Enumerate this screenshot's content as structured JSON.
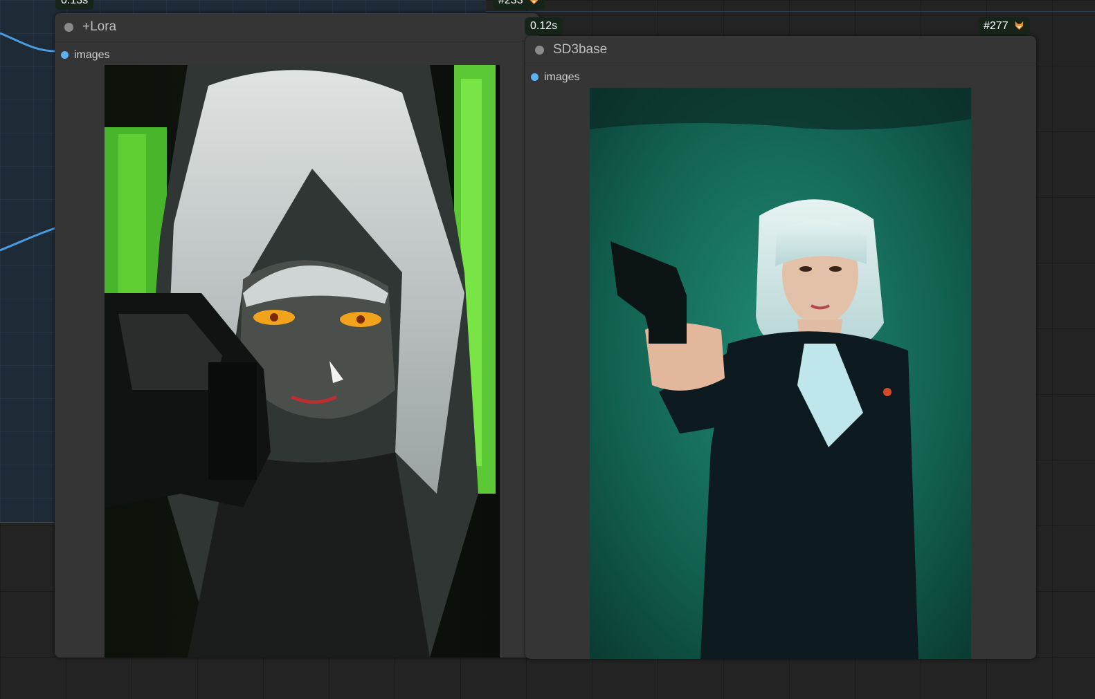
{
  "badges": {
    "time_top_left": "0.13s",
    "id_top": "#233",
    "time_right": "0.12s",
    "id_right": "#277"
  },
  "nodes": [
    {
      "title": "+Lora",
      "output_label": "images",
      "image_description": "anime-style girl with silver hair and glowing orange eyes aiming a pistol, green neon background"
    },
    {
      "title": "SD3base",
      "output_label": "images",
      "image_description": "photo of woman with white bob haircut in black suit aiming a pistol, teal background"
    }
  ],
  "colors": {
    "canvas": "#232323",
    "group": "#1e2a36",
    "node": "#353535",
    "slot": "#5fb2f0",
    "wire": "#4a9be0",
    "badge": "#16241a"
  },
  "icons": {
    "badge_icon": "fox-icon",
    "status_icon": "node-status-dot"
  }
}
